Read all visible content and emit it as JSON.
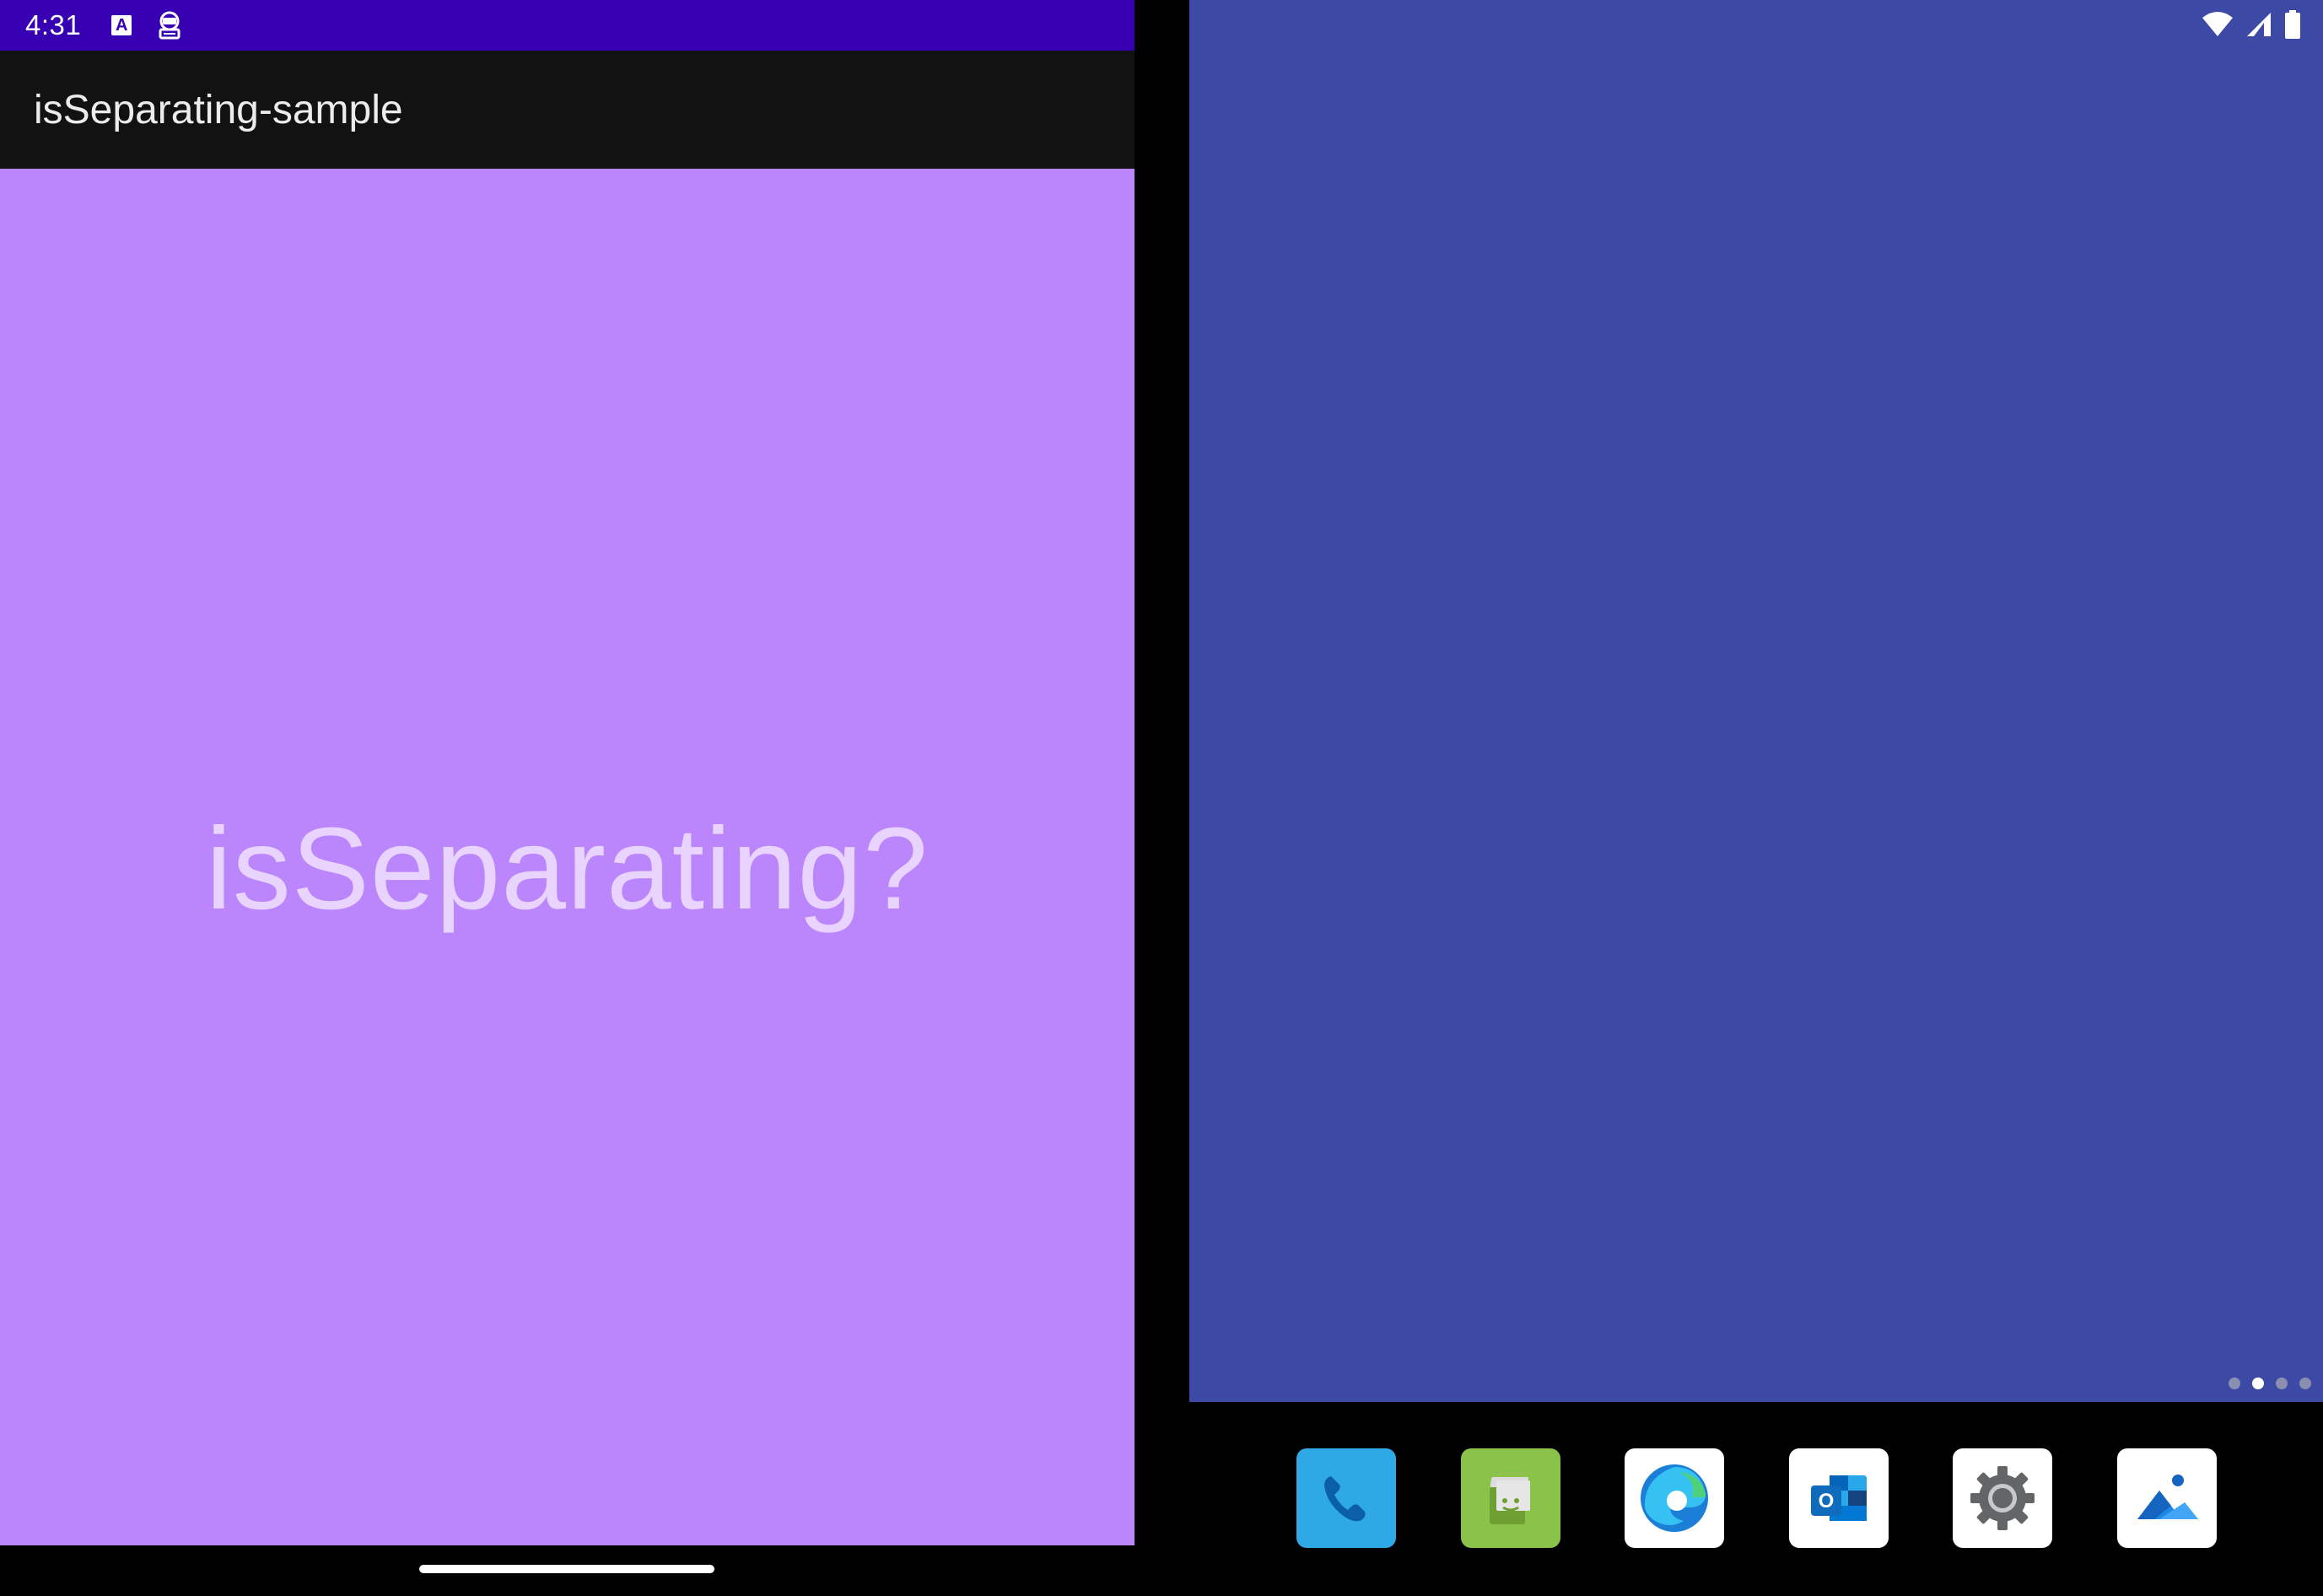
{
  "status_bar": {
    "time": "4:31",
    "notification_icons": [
      "accessibility-a-icon",
      "debug-android-icon"
    ]
  },
  "app_bar": {
    "title": "isSeparating-sample"
  },
  "content": {
    "label": "isSeparating?"
  },
  "right_status": {
    "icons": [
      "wifi-icon",
      "cellular-signal-icon",
      "battery-icon"
    ]
  },
  "launcher": {
    "page_count": 4,
    "current_page_index": 1,
    "dock_apps": [
      {
        "name": "phone-app-icon",
        "color": "#2fa9e6"
      },
      {
        "name": "messages-app-icon",
        "color": "#8bc34a"
      },
      {
        "name": "edge-app-icon",
        "color": "#ffffff"
      },
      {
        "name": "outlook-app-icon",
        "color": "#ffffff"
      },
      {
        "name": "settings-app-icon",
        "color": "#ffffff"
      },
      {
        "name": "gallery-app-icon",
        "color": "#ffffff"
      }
    ]
  },
  "colors": {
    "status_bar": "#3700b3",
    "app_bar": "#121212",
    "content_background": "#bb86fc",
    "content_text": "#e8d4ff",
    "wallpaper": "#3c4aa6",
    "hinge": "#000000"
  }
}
